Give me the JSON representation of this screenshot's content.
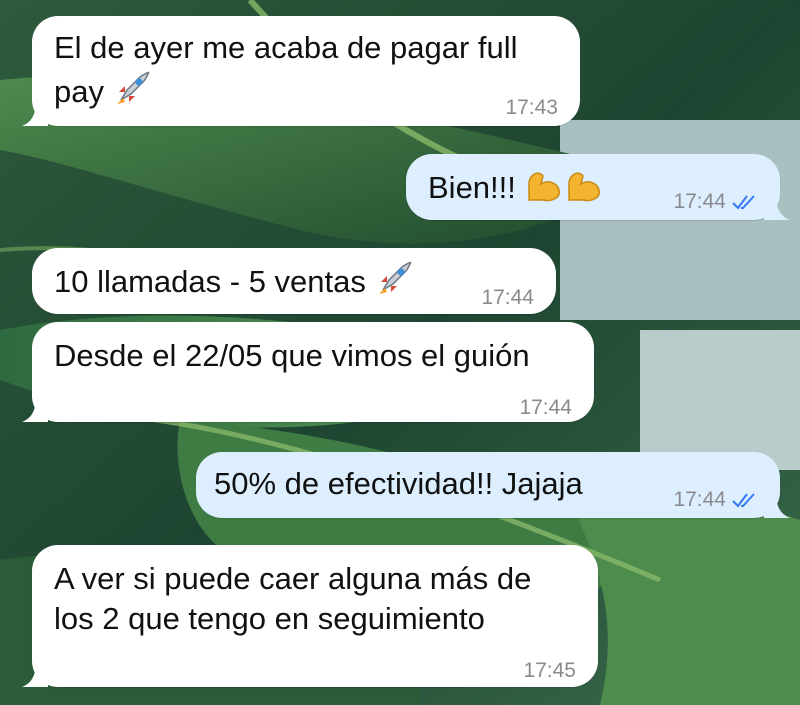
{
  "colors": {
    "incoming_bubble": "#ffffff",
    "outgoing_bubble": "#ddefff",
    "read_ticks": "#3478f6",
    "timestamp": "#8a8a8e"
  },
  "messages": [
    {
      "direction": "incoming",
      "text": "El de ayer me acaba de pagar full\npay",
      "emoji": "rocket",
      "time": "17:43"
    },
    {
      "direction": "outgoing",
      "text": "Bien!!!",
      "emoji": "flexed-biceps x2",
      "time": "17:44",
      "status": "read"
    },
    {
      "direction": "incoming",
      "text": "10 llamadas - 5 ventas",
      "emoji": "rocket",
      "time": "17:44"
    },
    {
      "direction": "incoming",
      "text": "Desde el 22/05 que vimos el guión",
      "time": "17:44"
    },
    {
      "direction": "outgoing",
      "text": "50% de efectividad!! Jajaja",
      "time": "17:44",
      "status": "read"
    },
    {
      "direction": "incoming",
      "text": "A ver si puede caer alguna más de\nlos 2 que tengo en seguimiento",
      "time": "17:45"
    }
  ]
}
